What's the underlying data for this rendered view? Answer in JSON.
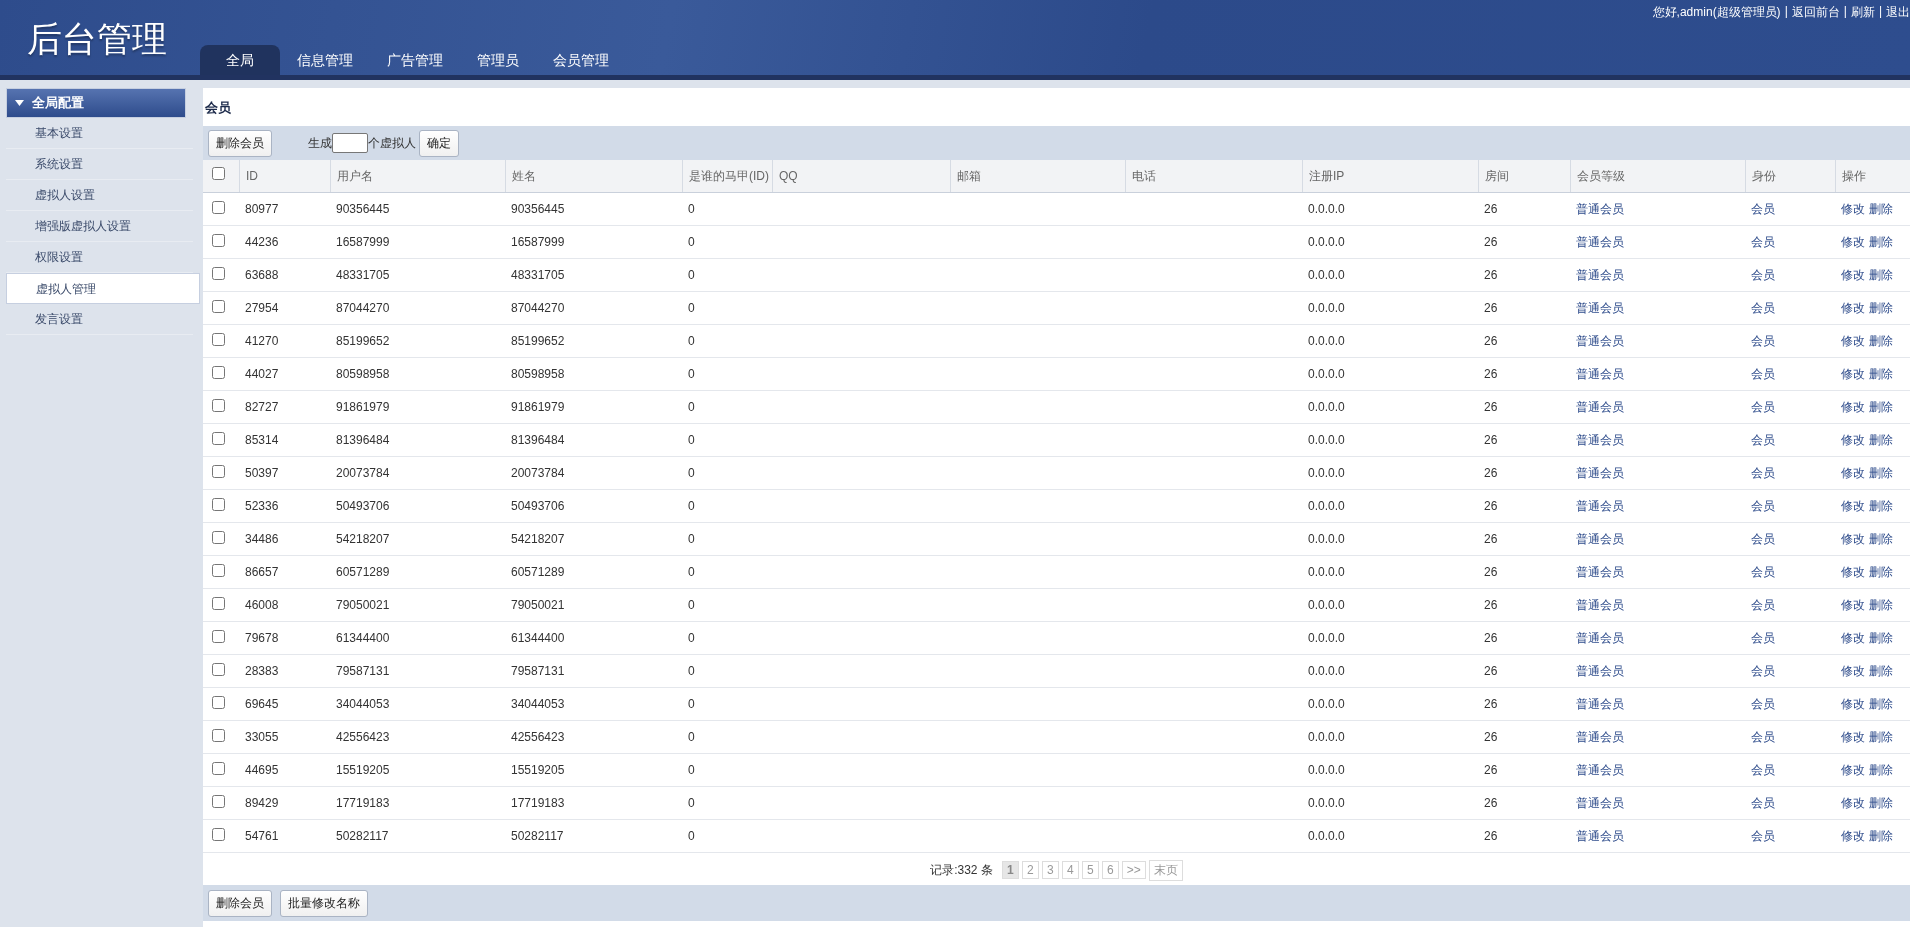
{
  "header": {
    "title": "后台管理",
    "greeting": "您好,admin(超级管理员)",
    "links": [
      "返回前台",
      "刷新",
      "退出"
    ],
    "separator": "|",
    "tabs": [
      {
        "label": "全局",
        "selected": true
      },
      {
        "label": "信息管理",
        "selected": false
      },
      {
        "label": "广告管理",
        "selected": false
      },
      {
        "label": "管理员",
        "selected": false
      },
      {
        "label": "会员管理",
        "selected": false
      }
    ]
  },
  "sidebar": {
    "section": {
      "title": "全局配置",
      "expanded": true
    },
    "items": [
      {
        "label": "基本设置",
        "selected": false
      },
      {
        "label": "系统设置",
        "selected": false
      },
      {
        "label": "虚拟人设置",
        "selected": false
      },
      {
        "label": "增强版虚拟人设置",
        "selected": false
      },
      {
        "label": "权限设置",
        "selected": false
      },
      {
        "label": "虚拟人管理",
        "selected": true
      },
      {
        "label": "发言设置",
        "selected": false
      }
    ]
  },
  "panel": {
    "title": "会员",
    "toolbar": {
      "delete_button": "删除会员",
      "generate_prefix": "生成",
      "generate_suffix": "个虚拟人",
      "confirm_button": "确定"
    },
    "table": {
      "select_all_checked": false,
      "columns": [
        "ID",
        "用户名",
        "姓名",
        "是谁的马甲(ID)",
        "QQ",
        "邮箱",
        "电话",
        "注册IP",
        "房间",
        "会员等级",
        "身份",
        "操作"
      ],
      "rows": [
        {
          "checked": false,
          "id": "80977",
          "username": "90356445",
          "name": "90356445",
          "alias_of": "0",
          "ip": "0.0.0.0",
          "room": "26",
          "level": "普通会员",
          "role": "会员",
          "actions": [
            "修改",
            "删除"
          ]
        },
        {
          "checked": false,
          "id": "44236",
          "username": "16587999",
          "name": "16587999",
          "alias_of": "0",
          "ip": "0.0.0.0",
          "room": "26",
          "level": "普通会员",
          "role": "会员",
          "actions": [
            "修改",
            "删除"
          ]
        },
        {
          "checked": false,
          "id": "63688",
          "username": "48331705",
          "name": "48331705",
          "alias_of": "0",
          "ip": "0.0.0.0",
          "room": "26",
          "level": "普通会员",
          "role": "会员",
          "actions": [
            "修改",
            "删除"
          ]
        },
        {
          "checked": false,
          "id": "27954",
          "username": "87044270",
          "name": "87044270",
          "alias_of": "0",
          "ip": "0.0.0.0",
          "room": "26",
          "level": "普通会员",
          "role": "会员",
          "actions": [
            "修改",
            "删除"
          ]
        },
        {
          "checked": false,
          "id": "41270",
          "username": "85199652",
          "name": "85199652",
          "alias_of": "0",
          "ip": "0.0.0.0",
          "room": "26",
          "level": "普通会员",
          "role": "会员",
          "actions": [
            "修改",
            "删除"
          ]
        },
        {
          "checked": false,
          "id": "44027",
          "username": "80598958",
          "name": "80598958",
          "alias_of": "0",
          "ip": "0.0.0.0",
          "room": "26",
          "level": "普通会员",
          "role": "会员",
          "actions": [
            "修改",
            "删除"
          ]
        },
        {
          "checked": false,
          "id": "82727",
          "username": "91861979",
          "name": "91861979",
          "alias_of": "0",
          "ip": "0.0.0.0",
          "room": "26",
          "level": "普通会员",
          "role": "会员",
          "actions": [
            "修改",
            "删除"
          ]
        },
        {
          "checked": false,
          "id": "85314",
          "username": "81396484",
          "name": "81396484",
          "alias_of": "0",
          "ip": "0.0.0.0",
          "room": "26",
          "level": "普通会员",
          "role": "会员",
          "actions": [
            "修改",
            "删除"
          ]
        },
        {
          "checked": false,
          "id": "50397",
          "username": "20073784",
          "name": "20073784",
          "alias_of": "0",
          "ip": "0.0.0.0",
          "room": "26",
          "level": "普通会员",
          "role": "会员",
          "actions": [
            "修改",
            "删除"
          ]
        },
        {
          "checked": false,
          "id": "52336",
          "username": "50493706",
          "name": "50493706",
          "alias_of": "0",
          "ip": "0.0.0.0",
          "room": "26",
          "level": "普通会员",
          "role": "会员",
          "actions": [
            "修改",
            "删除"
          ]
        },
        {
          "checked": false,
          "id": "34486",
          "username": "54218207",
          "name": "54218207",
          "alias_of": "0",
          "ip": "0.0.0.0",
          "room": "26",
          "level": "普通会员",
          "role": "会员",
          "actions": [
            "修改",
            "删除"
          ]
        },
        {
          "checked": false,
          "id": "86657",
          "username": "60571289",
          "name": "60571289",
          "alias_of": "0",
          "ip": "0.0.0.0",
          "room": "26",
          "level": "普通会员",
          "role": "会员",
          "actions": [
            "修改",
            "删除"
          ]
        },
        {
          "checked": false,
          "id": "46008",
          "username": "79050021",
          "name": "79050021",
          "alias_of": "0",
          "ip": "0.0.0.0",
          "room": "26",
          "level": "普通会员",
          "role": "会员",
          "actions": [
            "修改",
            "删除"
          ]
        },
        {
          "checked": false,
          "id": "79678",
          "username": "61344400",
          "name": "61344400",
          "alias_of": "0",
          "ip": "0.0.0.0",
          "room": "26",
          "level": "普通会员",
          "role": "会员",
          "actions": [
            "修改",
            "删除"
          ]
        },
        {
          "checked": false,
          "id": "28383",
          "username": "79587131",
          "name": "79587131",
          "alias_of": "0",
          "ip": "0.0.0.0",
          "room": "26",
          "level": "普通会员",
          "role": "会员",
          "actions": [
            "修改",
            "删除"
          ]
        },
        {
          "checked": false,
          "id": "69645",
          "username": "34044053",
          "name": "34044053",
          "alias_of": "0",
          "ip": "0.0.0.0",
          "room": "26",
          "level": "普通会员",
          "role": "会员",
          "actions": [
            "修改",
            "删除"
          ]
        },
        {
          "checked": false,
          "id": "33055",
          "username": "42556423",
          "name": "42556423",
          "alias_of": "0",
          "ip": "0.0.0.0",
          "room": "26",
          "level": "普通会员",
          "role": "会员",
          "actions": [
            "修改",
            "删除"
          ]
        },
        {
          "checked": false,
          "id": "44695",
          "username": "15519205",
          "name": "15519205",
          "alias_of": "0",
          "ip": "0.0.0.0",
          "room": "26",
          "level": "普通会员",
          "role": "会员",
          "actions": [
            "修改",
            "删除"
          ]
        },
        {
          "checked": false,
          "id": "89429",
          "username": "17719183",
          "name": "17719183",
          "alias_of": "0",
          "ip": "0.0.0.0",
          "room": "26",
          "level": "普通会员",
          "role": "会员",
          "actions": [
            "修改",
            "删除"
          ]
        },
        {
          "checked": false,
          "id": "54761",
          "username": "50282117",
          "name": "50282117",
          "alias_of": "0",
          "ip": "0.0.0.0",
          "room": "26",
          "level": "普通会员",
          "role": "会员",
          "actions": [
            "修改",
            "删除"
          ]
        }
      ]
    },
    "pagination": {
      "summary": "记录:332 条",
      "pages": [
        {
          "label": "1",
          "selected": true
        },
        {
          "label": "2",
          "selected": false
        },
        {
          "label": "3",
          "selected": false
        },
        {
          "label": "4",
          "selected": false
        },
        {
          "label": "5",
          "selected": false
        },
        {
          "label": "6",
          "selected": false
        }
      ],
      "next": ">>",
      "last": "末页"
    },
    "bottom_buttons": [
      "删除会员",
      "批量修改名称"
    ]
  }
}
